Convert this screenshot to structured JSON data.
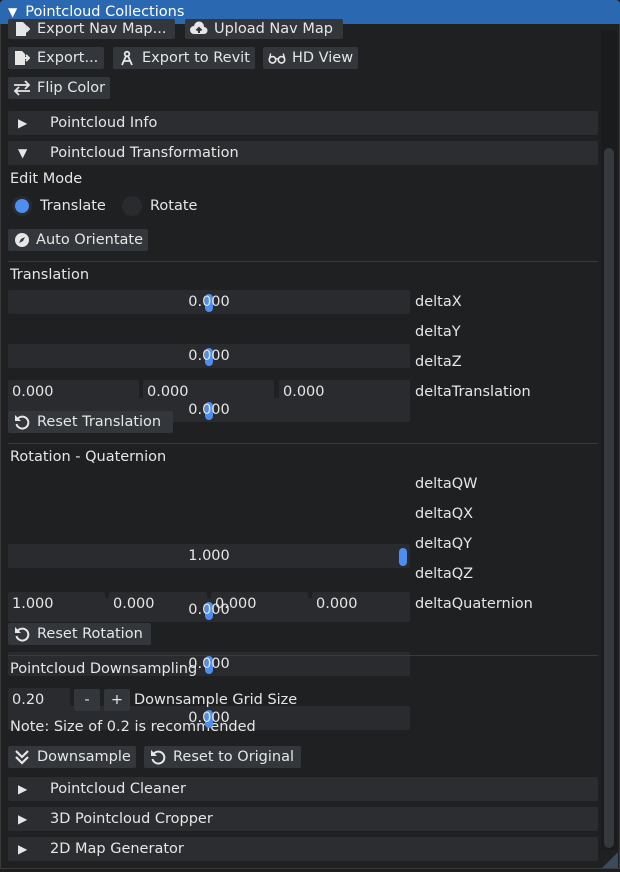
{
  "window": {
    "title": "Pointcloud Collections"
  },
  "toolbar": {
    "export_nav_map": "Export Nav Map...",
    "upload_nav_map": "Upload Nav Map",
    "export": "Export...",
    "export_revit": "Export to Revit",
    "hd_view": "HD View",
    "flip_color": "Flip Color"
  },
  "sections": {
    "info": "Pointcloud Info",
    "transformation": "Pointcloud Transformation",
    "cleaner": "Pointcloud Cleaner",
    "cropper": "3D Pointcloud Cropper",
    "map_generator": "2D Map Generator"
  },
  "edit_mode": {
    "label": "Edit Mode",
    "translate": "Translate",
    "rotate": "Rotate",
    "selected": "Translate",
    "auto_orientate": "Auto Orientate"
  },
  "translation": {
    "title": "Translation",
    "deltaX": {
      "value": "0.000",
      "label": "deltaX"
    },
    "deltaY": {
      "value": "0.000",
      "label": "deltaY"
    },
    "deltaZ": {
      "value": "0.000",
      "label": "deltaZ"
    },
    "delta_values": [
      "0.000",
      "0.000",
      "0.000"
    ],
    "delta_label": "deltaTranslation",
    "reset": "Reset Translation"
  },
  "rotation": {
    "title": "Rotation - Quaternion",
    "deltaQW": {
      "value": "1.000",
      "label": "deltaQW"
    },
    "deltaQX": {
      "value": "0.000",
      "label": "deltaQX"
    },
    "deltaQY": {
      "value": "0.000",
      "label": "deltaQY"
    },
    "deltaQZ": {
      "value": "0.000",
      "label": "deltaQZ"
    },
    "delta_values": [
      "1.000",
      "0.000",
      "0.000",
      "0.000"
    ],
    "delta_label": "deltaQuaternion",
    "reset": "Reset Rotation"
  },
  "downsampling": {
    "title": "Pointcloud Downsampling",
    "grid_value": "0.20",
    "minus": "-",
    "plus": "+",
    "grid_label": "Downsample Grid Size",
    "note": "Note: Size of 0.2 is recommended",
    "downsample": "Downsample",
    "reset_original": "Reset to Original"
  },
  "colors": {
    "accent": "#4e8ef0",
    "title_bar": "#2a68b2",
    "panel_bg": "#1f2022",
    "button_bg": "#33363a"
  }
}
